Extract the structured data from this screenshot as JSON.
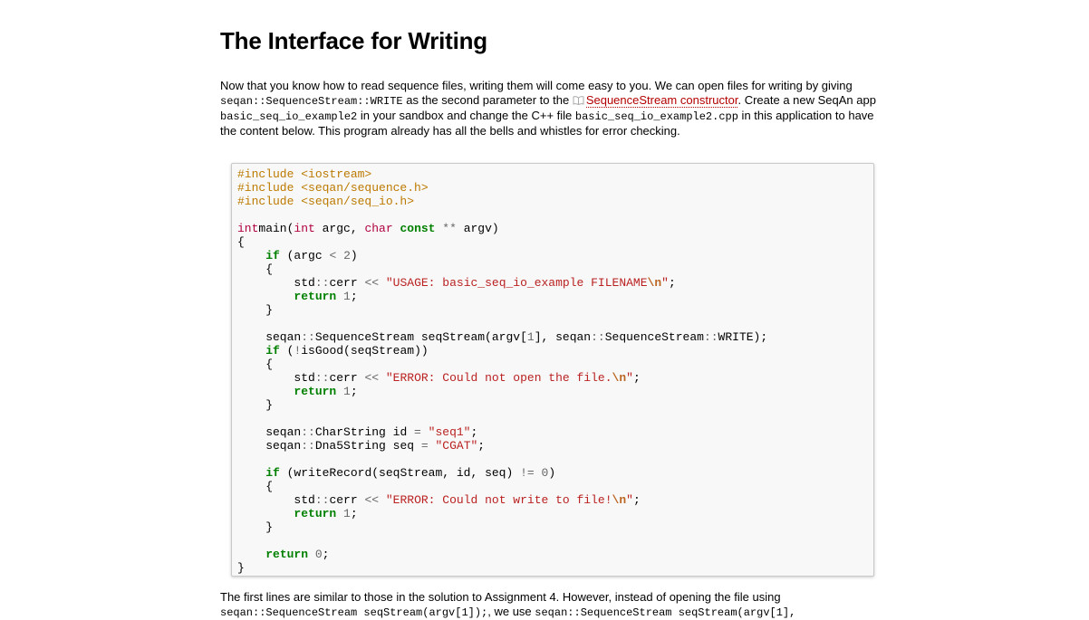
{
  "title": "The Interface for Writing",
  "intro": {
    "t1": "Now that you know how to read sequence files, writing them will come easy to you. We can open files for writing by giving ",
    "c1": "seqan::SequenceStream::WRITE",
    "t2": " as the second parameter to the ",
    "link": "SequenceStream constructor",
    "link_icon": "book-icon",
    "t3": ". Create a new SeqAn app ",
    "c2": "basic_seq_io_example2",
    "t4": " in your sandbox and change the C++ file ",
    "c3": "basic_seq_io_example2.cpp",
    "t5": " in this application to have the content below. This program already has all the bells and whistles for error checking."
  },
  "code_lines": [
    [
      [
        "cp",
        "#include <iostream>"
      ]
    ],
    [
      [
        "cp",
        "#include <seqan/sequence.h>"
      ]
    ],
    [
      [
        "cp",
        "#include <seqan/seq_io.h>"
      ]
    ],
    [],
    [
      [
        "kt",
        "int"
      ],
      [
        "",
        "main("
      ],
      [
        "kt",
        "int"
      ],
      [
        "",
        " argc, "
      ],
      [
        "kt",
        "char"
      ],
      [
        "",
        " "
      ],
      [
        "k",
        "const"
      ],
      [
        "",
        " "
      ],
      [
        "o",
        "**"
      ],
      [
        "",
        " argv)"
      ]
    ],
    [
      [
        "",
        "{"
      ]
    ],
    [
      [
        "",
        "    "
      ],
      [
        "k",
        "if"
      ],
      [
        "",
        " (argc "
      ],
      [
        "o",
        "<"
      ],
      [
        "",
        " "
      ],
      [
        "mi",
        "2"
      ],
      [
        "",
        ")"
      ]
    ],
    [
      [
        "",
        "    {"
      ]
    ],
    [
      [
        "",
        "        std"
      ],
      [
        "o",
        "::"
      ],
      [
        "",
        "cerr "
      ],
      [
        "o",
        "<<"
      ],
      [
        "",
        " "
      ],
      [
        "s",
        "\"USAGE: basic_seq_io_example FILENAME"
      ],
      [
        "se",
        "\\n"
      ],
      [
        "s",
        "\""
      ],
      [
        "",
        ";"
      ]
    ],
    [
      [
        "",
        "        "
      ],
      [
        "k",
        "return"
      ],
      [
        "",
        " "
      ],
      [
        "mi",
        "1"
      ],
      [
        "",
        ";"
      ]
    ],
    [
      [
        "",
        "    }"
      ]
    ],
    [],
    [
      [
        "",
        "    seqan"
      ],
      [
        "o",
        "::"
      ],
      [
        "",
        "SequenceStream seqStream(argv["
      ],
      [
        "mi",
        "1"
      ],
      [
        "",
        "], seqan"
      ],
      [
        "o",
        "::"
      ],
      [
        "",
        "SequenceStream"
      ],
      [
        "o",
        "::"
      ],
      [
        "",
        "WRITE);"
      ]
    ],
    [
      [
        "",
        "    "
      ],
      [
        "k",
        "if"
      ],
      [
        "",
        " ("
      ],
      [
        "o",
        "!"
      ],
      [
        "",
        "isGood(seqStream))"
      ]
    ],
    [
      [
        "",
        "    {"
      ]
    ],
    [
      [
        "",
        "        std"
      ],
      [
        "o",
        "::"
      ],
      [
        "",
        "cerr "
      ],
      [
        "o",
        "<<"
      ],
      [
        "",
        " "
      ],
      [
        "s",
        "\"ERROR: Could not open the file."
      ],
      [
        "se",
        "\\n"
      ],
      [
        "s",
        "\""
      ],
      [
        "",
        ";"
      ]
    ],
    [
      [
        "",
        "        "
      ],
      [
        "k",
        "return"
      ],
      [
        "",
        " "
      ],
      [
        "mi",
        "1"
      ],
      [
        "",
        ";"
      ]
    ],
    [
      [
        "",
        "    }"
      ]
    ],
    [],
    [
      [
        "",
        "    seqan"
      ],
      [
        "o",
        "::"
      ],
      [
        "",
        "CharString id "
      ],
      [
        "o",
        "="
      ],
      [
        "",
        " "
      ],
      [
        "s",
        "\"seq1\""
      ],
      [
        "",
        ";"
      ]
    ],
    [
      [
        "",
        "    seqan"
      ],
      [
        "o",
        "::"
      ],
      [
        "",
        "Dna5String seq "
      ],
      [
        "o",
        "="
      ],
      [
        "",
        " "
      ],
      [
        "s",
        "\"CGAT\""
      ],
      [
        "",
        ";"
      ]
    ],
    [],
    [
      [
        "",
        "    "
      ],
      [
        "k",
        "if"
      ],
      [
        "",
        " (writeRecord(seqStream, id, seq) "
      ],
      [
        "o",
        "!="
      ],
      [
        "",
        " "
      ],
      [
        "mi",
        "0"
      ],
      [
        "",
        ")"
      ]
    ],
    [
      [
        "",
        "    {"
      ]
    ],
    [
      [
        "",
        "        std"
      ],
      [
        "o",
        "::"
      ],
      [
        "",
        "cerr "
      ],
      [
        "o",
        "<<"
      ],
      [
        "",
        " "
      ],
      [
        "s",
        "\"ERROR: Could not write to file!"
      ],
      [
        "se",
        "\\n"
      ],
      [
        "s",
        "\""
      ],
      [
        "",
        ";"
      ]
    ],
    [
      [
        "",
        "        "
      ],
      [
        "k",
        "return"
      ],
      [
        "",
        " "
      ],
      [
        "mi",
        "1"
      ],
      [
        "",
        ";"
      ]
    ],
    [
      [
        "",
        "    }"
      ]
    ],
    [],
    [
      [
        "",
        "    "
      ],
      [
        "k",
        "return"
      ],
      [
        "",
        " "
      ],
      [
        "mi",
        "0"
      ],
      [
        "",
        ";"
      ]
    ],
    [
      [
        "",
        "}"
      ]
    ]
  ],
  "outro": {
    "t1": "The first lines are similar to those in the solution to Assignment 4. However, instead of opening the file using",
    "c1": "seqan::SequenceStream seqStream(argv[1]);",
    "t2": ", we use ",
    "c2": "seqan::SequenceStream seqStream(argv[1],"
  },
  "colors": {
    "link": "#b30000",
    "code_bg": "#f8f8f8",
    "preproc": "#bc7a00",
    "keyword": "#008000",
    "type": "#b00040",
    "string": "#ba2121"
  }
}
